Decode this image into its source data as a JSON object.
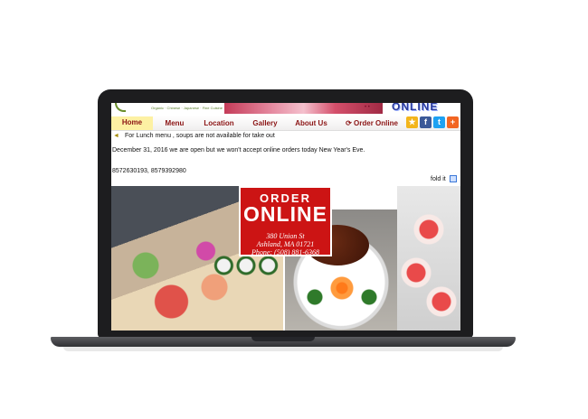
{
  "banner": {
    "tagline": "Organic · Chinese · Japanese · Fine Cuisine",
    "brand": "ONLINE",
    "dots": "• •"
  },
  "nav": {
    "items": [
      {
        "label": "Home"
      },
      {
        "label": "Menu"
      },
      {
        "label": "Location"
      },
      {
        "label": "Gallery"
      },
      {
        "label": "About Us"
      },
      {
        "label": "Order Online"
      }
    ]
  },
  "social": [
    {
      "name": "favorite",
      "glyph": "★",
      "color": "#f3b51b"
    },
    {
      "name": "facebook",
      "glyph": "f",
      "color": "#3b5998"
    },
    {
      "name": "twitter",
      "glyph": "t",
      "color": "#1da1f2"
    },
    {
      "name": "share",
      "glyph": "+",
      "color": "#f26522"
    }
  ],
  "notice": {
    "lunch": "For Lunch menu , soups are not available for take out",
    "holiday": "December 31, 2016 we are open but we won't accept online orders today New Year's Eve.",
    "phones": "8572630193, 8579392980",
    "fold": "fold it"
  },
  "order_card": {
    "line1": "ORDER",
    "line2": "ONLINE",
    "address1": "380 Union St",
    "address2": "Ashland, MA 01721",
    "phone": "Phone: (508) 881-6368"
  }
}
